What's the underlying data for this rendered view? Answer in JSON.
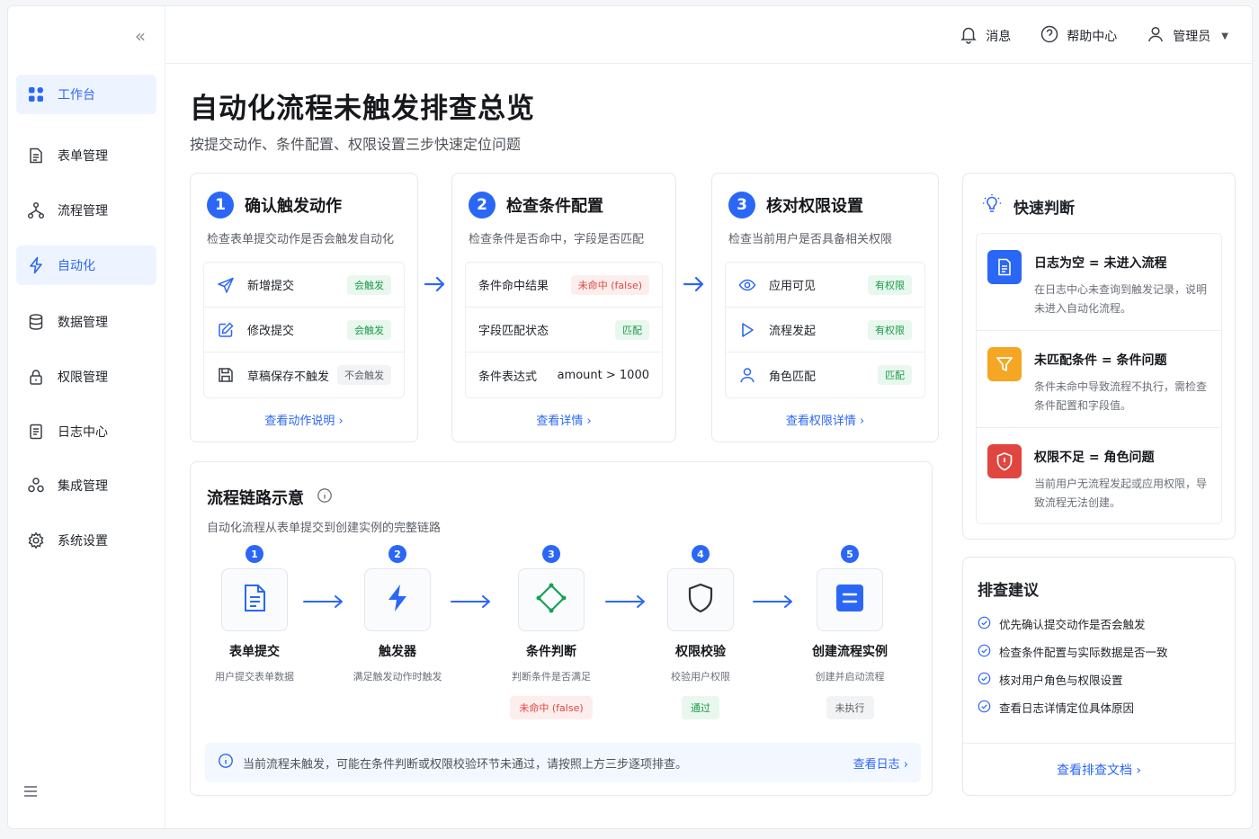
{
  "colors": {
    "primary": "#2b67f6",
    "success": "#1c9a4a",
    "danger": "#e0463f",
    "warning": "#f5a623"
  },
  "sidebar": {
    "items": [
      {
        "label": "工作台",
        "icon": "grid-icon",
        "active": true
      },
      {
        "label": "表单管理",
        "icon": "form-icon",
        "active": false
      },
      {
        "label": "流程管理",
        "icon": "flow-icon",
        "active": false
      },
      {
        "label": "自动化",
        "icon": "lightning-icon",
        "active": true
      },
      {
        "label": "数据管理",
        "icon": "database-icon",
        "active": false
      },
      {
        "label": "权限管理",
        "icon": "lock-icon",
        "active": false
      },
      {
        "label": "日志中心",
        "icon": "log-icon",
        "active": false
      },
      {
        "label": "集成管理",
        "icon": "integration-icon",
        "active": false
      },
      {
        "label": "系统设置",
        "icon": "gear-icon",
        "active": false
      }
    ]
  },
  "header": {
    "messages": "消息",
    "help": "帮助中心",
    "user": "管理员"
  },
  "page": {
    "title": "自动化流程未触发排查总览",
    "subtitle": "按提交动作、条件配置、权限设置三步快速定位问题"
  },
  "steps": [
    {
      "num": "1",
      "title": "确认触发动作",
      "desc": "检查表单提交动作是否会触发自动化",
      "rows": [
        {
          "label": "新增提交",
          "tag": "会触发",
          "tone": "green",
          "icon": "send-icon"
        },
        {
          "label": "修改提交",
          "tag": "会触发",
          "tone": "green",
          "icon": "edit-icon"
        },
        {
          "label": "草稿保存不触发",
          "tag": "不会触发",
          "tone": "gray",
          "icon": "save-icon"
        }
      ],
      "link": "查看动作说明 ›"
    },
    {
      "num": "2",
      "title": "检查条件配置",
      "desc": "检查条件是否命中，字段是否匹配",
      "rows": [
        {
          "label": "条件命中结果",
          "tag": "未命中 (false)",
          "tone": "red"
        },
        {
          "label": "字段匹配状态",
          "tag": "匹配",
          "tone": "green"
        },
        {
          "label": "条件表达式",
          "value": "amount > 1000"
        }
      ],
      "link": "查看详情 ›"
    },
    {
      "num": "3",
      "title": "核对权限设置",
      "desc": "检查当前用户是否具备相关权限",
      "rows": [
        {
          "label": "应用可见",
          "tag": "有权限",
          "tone": "green",
          "icon": "eye-icon"
        },
        {
          "label": "流程发起",
          "tag": "有权限",
          "tone": "green",
          "icon": "play-icon"
        },
        {
          "label": "角色匹配",
          "tag": "匹配",
          "tone": "green",
          "icon": "user-icon"
        }
      ],
      "link": "查看权限详情 ›"
    }
  ],
  "flow": {
    "title": "流程链路示意",
    "desc": "自动化流程从表单提交到创建实例的完整链路",
    "nodes": [
      {
        "num": "1",
        "title": "表单提交",
        "desc": "用户提交表单数据",
        "icon": "document-icon"
      },
      {
        "num": "2",
        "title": "触发器",
        "desc": "满足触发动作时触发",
        "icon": "lightning-icon"
      },
      {
        "num": "3",
        "title": "条件判断",
        "desc": "判断条件是否满足",
        "icon": "diamond-icon",
        "tag": "未命中 (false)",
        "tone": "red"
      },
      {
        "num": "4",
        "title": "权限校验",
        "desc": "校验用户权限",
        "icon": "shield-icon",
        "tag": "通过",
        "tone": "green"
      },
      {
        "num": "5",
        "title": "创建流程实例",
        "desc": "创建并启动流程",
        "icon": "list-icon",
        "tag": "未执行",
        "tone": "gray"
      }
    ],
    "note": "当前流程未触发，可能在条件判断或权限校验环节未通过，请按照上方三步逐项排查。",
    "note_link": "查看日志 ›"
  },
  "quick": {
    "title": "快速判断",
    "items": [
      {
        "title": "日志为空 = 未进入流程",
        "desc": "在日志中心未查询到触发记录，说明未进入自动化流程。",
        "color": "#2b67f6",
        "icon": "document-icon"
      },
      {
        "title": "未匹配条件 = 条件问题",
        "desc": "条件未命中导致流程不执行，需检查条件配置和字段值。",
        "color": "#f5a623",
        "icon": "filter-icon"
      },
      {
        "title": "权限不足 = 角色问题",
        "desc": "当前用户无流程发起或应用权限，导致流程无法创建。",
        "color": "#e0463f",
        "icon": "shield-icon"
      }
    ]
  },
  "suggest": {
    "title": "排查建议",
    "items": [
      "优先确认提交动作是否会触发",
      "检查条件配置与实际数据是否一致",
      "核对用户角色与权限设置",
      "查看日志详情定位具体原因"
    ],
    "link": "查看排查文档 ›"
  }
}
